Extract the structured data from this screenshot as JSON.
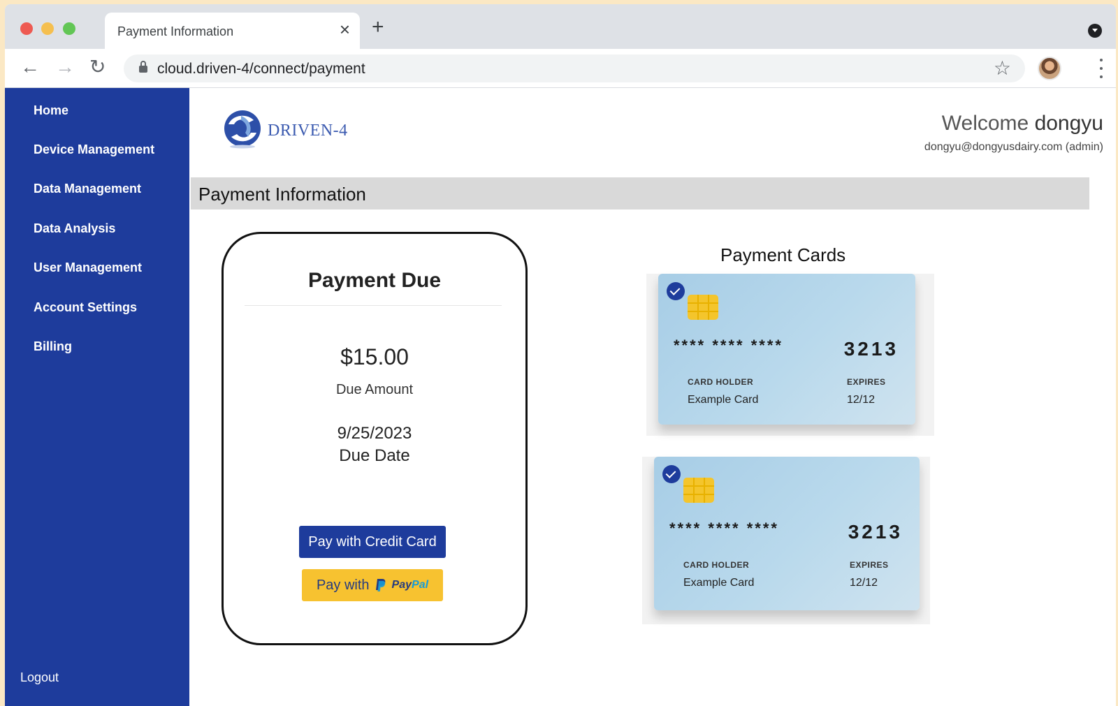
{
  "browser": {
    "tab_title": "Payment Information",
    "url": "cloud.driven-4/connect/payment"
  },
  "sidebar": {
    "items": [
      {
        "label": "Home"
      },
      {
        "label": "Device Management"
      },
      {
        "label": "Data Management"
      },
      {
        "label": "Data Analysis"
      },
      {
        "label": "User Management"
      },
      {
        "label": "Account Settings"
      },
      {
        "label": "Billing"
      }
    ],
    "logout_label": "Logout"
  },
  "header": {
    "logo_text": "DRIVEN-4",
    "welcome_prefix": "Welcome",
    "username": "dongyu",
    "user_email": "dongyu@dongyusdairy.com (admin)"
  },
  "page": {
    "title": "Payment Information"
  },
  "payment_due": {
    "title": "Payment Due",
    "amount": "$15.00",
    "amount_label": "Due Amount",
    "due_date": "9/25/2023",
    "due_date_label": "Due Date",
    "credit_button_label": "Pay with Credit Card",
    "paypal_prefix": "Pay with",
    "paypal_brand_pay": "Pay",
    "paypal_brand_pal": "Pal"
  },
  "payment_cards": {
    "title": "Payment Cards",
    "holder_label": "CARD HOLDER",
    "expires_label": "EXPIRES",
    "cards": [
      {
        "masked": "**** **** ****",
        "last4": "3213",
        "holder": "Example Card",
        "expires": "12/12",
        "selected": true
      },
      {
        "masked": "**** **** ****",
        "last4": "3213",
        "holder": "Example Card",
        "expires": "12/12",
        "selected": true
      }
    ]
  },
  "colors": {
    "sidebar_bg": "#1e3c9c",
    "primary_button": "#1e3c9c",
    "paypal_button": "#f7c230",
    "card_gradient_start": "#a7cde6",
    "chip": "#f4c52c"
  },
  "icons": [
    "close-icon",
    "plus-icon",
    "back-arrow-icon",
    "forward-arrow-icon",
    "reload-icon",
    "lock-icon",
    "star-icon",
    "kebab-menu-icon",
    "profile-menu-icon",
    "driven-logo-icon",
    "check-icon",
    "chip-icon",
    "paypal-icon"
  ]
}
